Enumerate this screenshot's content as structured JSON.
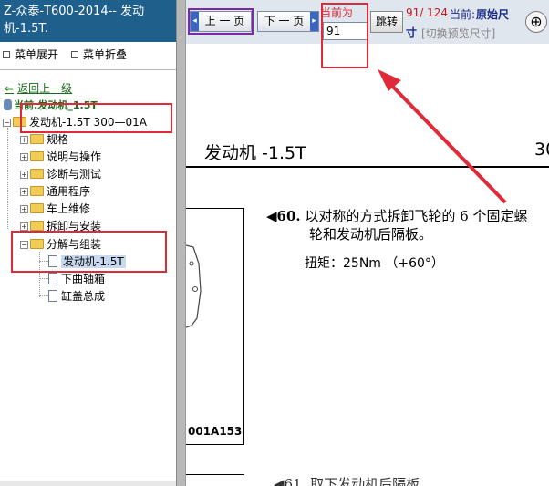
{
  "left_pane": {
    "title": "Z-众泰-T600-2014-- 发动机-1.5T.",
    "menu_expand": "菜单展开",
    "menu_collapse": "菜单折叠",
    "back_link": "返回上一级",
    "current": "当前:发动机_1.5T",
    "tree": {
      "root": "发动机-1.5T 300—01A",
      "items": [
        "规格",
        "说明与操作",
        "诊断与测试",
        "通用程序",
        "车上维修",
        "拆卸与安装",
        "分解与组装"
      ],
      "children": [
        "发动机-1.5T",
        "下曲轴箱",
        "缸盖总成"
      ]
    }
  },
  "toolbar": {
    "prev_label": "上 一 页",
    "next_label": "下 一 页",
    "current_label": "当前为",
    "page_value": "91",
    "jump_label": "跳转",
    "page_count": "91/ 124",
    "current_size_label": "当前:",
    "original_size": "原始尺",
    "original_size_tail": "寸",
    "switch_size": "[切换预览尺寸]",
    "zoom_icon": "zoom-in-icon"
  },
  "document": {
    "section_title": "发动机 -1.5T",
    "section_title_cut": "30",
    "step_marker": "◀60.",
    "step_text_line1": "以对称的方式拆卸飞轮的 6 个固定螺",
    "step_text_line2": "轮和发动机后隔板。",
    "torque_label": "扭矩：",
    "torque_value": "25Nm （+60°）",
    "figure_code": "001A153",
    "next_step_partial": "◀61. 取下发动机后隔板"
  },
  "colors": {
    "title_bg": "#1f5f8b",
    "annotation_red": "#e02a3a",
    "link_green": "#1a6a1a"
  }
}
